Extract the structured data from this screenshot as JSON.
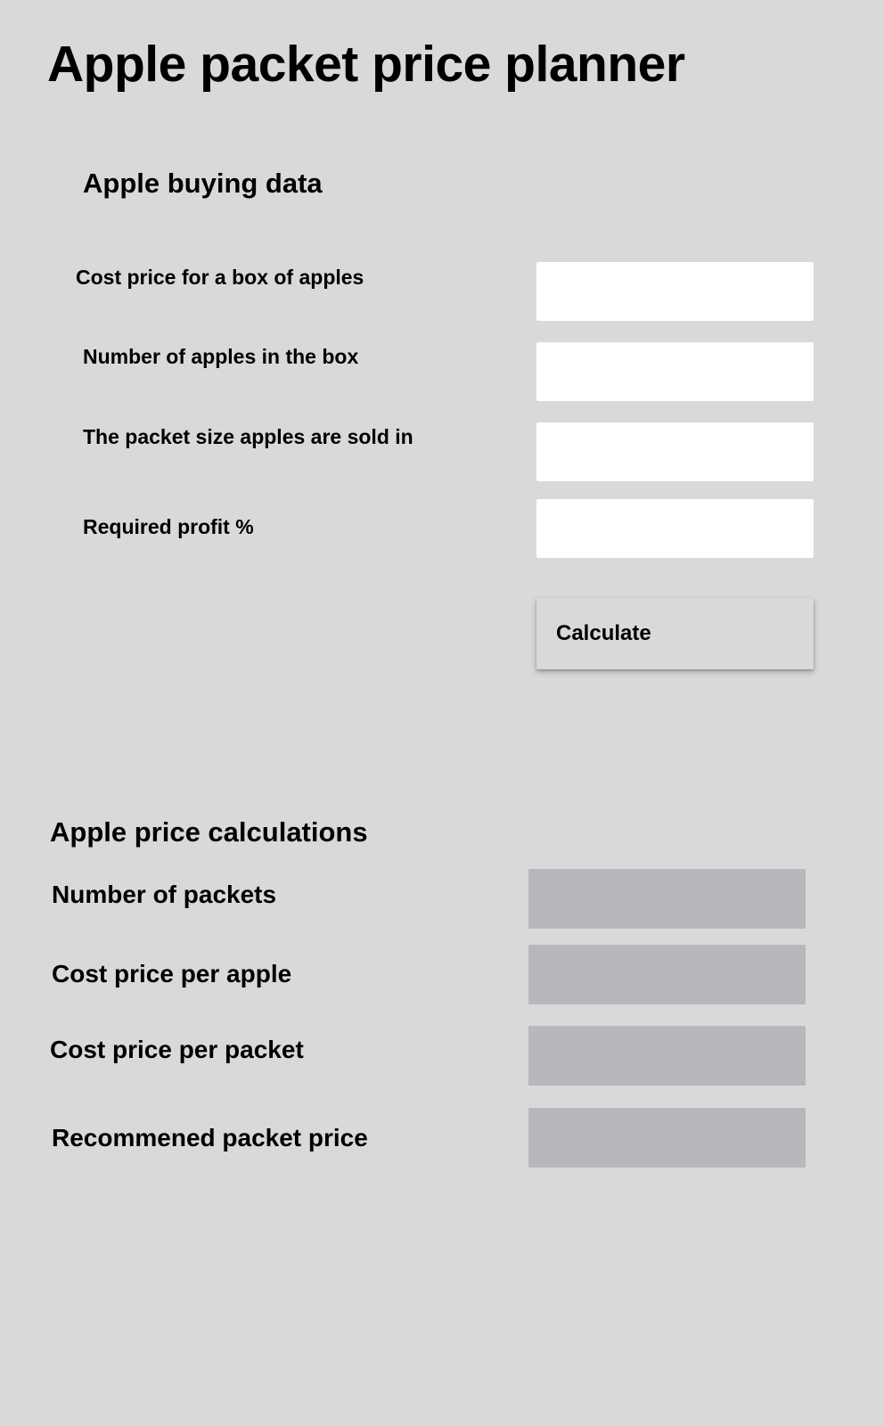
{
  "page": {
    "title": "Apple packet price planner"
  },
  "buying": {
    "title": "Apple buying data",
    "fields": [
      {
        "label": "Cost price for a box of apples",
        "value": "",
        "placeholder": ""
      },
      {
        "label": "Number of apples in the box",
        "value": "",
        "placeholder": ""
      },
      {
        "label": "The packet size apples are sold in",
        "value": "",
        "placeholder": ""
      },
      {
        "label": "Required profit %",
        "value": "",
        "placeholder": ""
      }
    ],
    "calculate_label": "Calculate"
  },
  "calculations": {
    "title": "Apple price calculations",
    "results": [
      {
        "label": "Number of packets",
        "value": ""
      },
      {
        "label": "Cost price per apple",
        "value": ""
      },
      {
        "label": "Cost price per packet",
        "value": ""
      },
      {
        "label": "Recommened packet price",
        "value": ""
      }
    ]
  },
  "colors": {
    "background": "#d9d9d9",
    "input_background": "#ffffff",
    "result_background": "#b8b8bc"
  }
}
